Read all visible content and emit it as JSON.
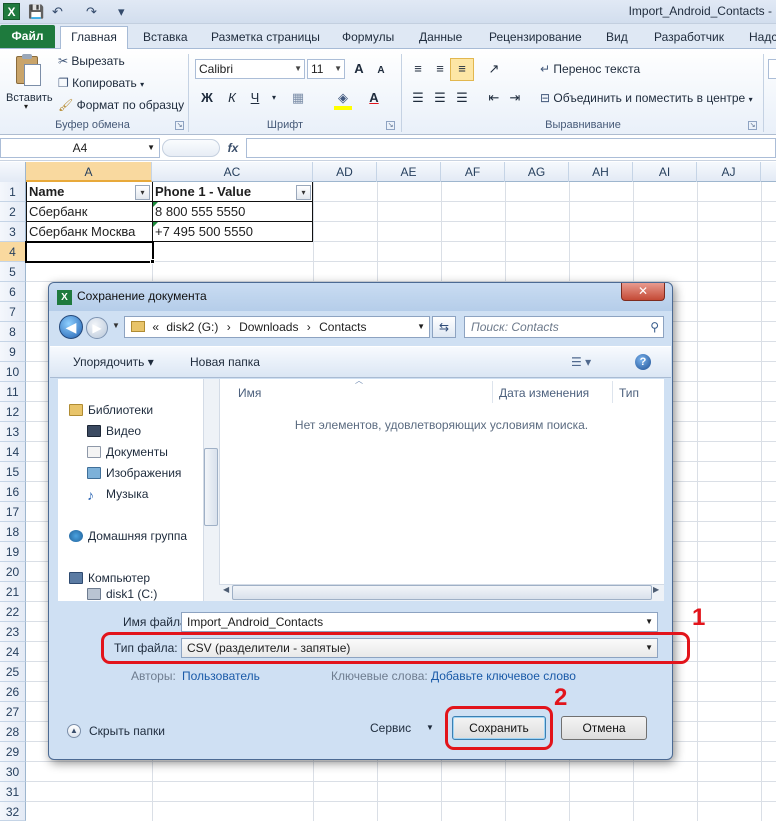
{
  "window": {
    "title": "Import_Android_Contacts -",
    "logo_letter": "X"
  },
  "quick_access": {
    "save": "💾",
    "undo": "↶",
    "redo": "↷",
    "customize": "▾"
  },
  "ribbon": {
    "tabs": {
      "file": "Файл",
      "home": "Главная",
      "insert": "Вставка",
      "page_layout": "Разметка страницы",
      "formulas": "Формулы",
      "data": "Данные",
      "review": "Рецензирование",
      "view": "Вид",
      "developer": "Разработчик",
      "more": "Надс"
    },
    "clipboard": {
      "paste": "Вставить",
      "cut": "Вырезать",
      "copy": "Копировать",
      "format_painter": "Формат по образцу",
      "group": "Буфер обмена"
    },
    "font": {
      "name": "Calibri",
      "size": "11",
      "grow": "A",
      "shrink": "A",
      "bold": "Ж",
      "italic": "К",
      "underline": "Ч",
      "font_color_letter": "A",
      "group": "Шрифт"
    },
    "alignment": {
      "wrap": "Перенос текста",
      "merge": "Объединить и поместить в центре",
      "group": "Выравнивание"
    },
    "dialog_launcher": "↘"
  },
  "formula_bar": {
    "namebox": "A4",
    "fx": "fx"
  },
  "sheet": {
    "columns": [
      "A",
      "AC",
      "AD",
      "AE",
      "AF",
      "AG",
      "AH",
      "AI",
      "AJ"
    ],
    "rows": [
      "1",
      "2",
      "3",
      "4",
      "5",
      "6",
      "7",
      "8",
      "9",
      "10",
      "11",
      "12",
      "13",
      "14",
      "15",
      "16",
      "17",
      "18",
      "19",
      "20",
      "21",
      "22",
      "23",
      "24",
      "25",
      "26",
      "27",
      "28",
      "29",
      "30",
      "31",
      "32"
    ],
    "cells": {
      "header_name": "Name",
      "header_phone": "Phone 1 - Value",
      "r2_name": "Сбербанк",
      "r2_phone": "8 800 555 5550",
      "r3_name": "Сбербанк Москва",
      "r3_phone": "+7 495 500 5550"
    },
    "filter_arrow": "▾"
  },
  "dialog": {
    "title": "Сохранение документа",
    "close": "✕",
    "address": {
      "prefix": "«",
      "segments": [
        "disk2 (G:)",
        "Downloads",
        "Contacts"
      ],
      "sep": "›"
    },
    "search_placeholder": "Поиск: Contacts",
    "toolbar": {
      "organize": "Упорядочить ▾",
      "new_folder": "Новая папка",
      "view": "☰ ▾",
      "help": "?"
    },
    "nav": {
      "libraries": "Библиотеки",
      "video": "Видео",
      "documents": "Документы",
      "images": "Изображения",
      "music": "Музыка",
      "homegroup": "Домашняя группа",
      "computer": "Компьютер",
      "disk1": "disk1 (C:)"
    },
    "columns": {
      "name": "Имя",
      "date": "Дата изменения",
      "type": "Тип"
    },
    "empty": "Нет элементов, удовлетворяющих условиям поиска.",
    "filename": {
      "label": "Имя файла:",
      "value": "Import_Android_Contacts"
    },
    "filetype": {
      "label": "Тип файла:",
      "value": "CSV (разделители - запятые)"
    },
    "authors": {
      "label": "Авторы:",
      "value": "Пользователь"
    },
    "tags": {
      "label": "Ключевые слова:",
      "value": "Добавьте ключевое слово"
    },
    "hide_folders": "Скрыть папки",
    "service": "Сервис",
    "save": "Сохранить",
    "cancel": "Отмена"
  },
  "annotations": {
    "one": "1",
    "two": "2"
  }
}
